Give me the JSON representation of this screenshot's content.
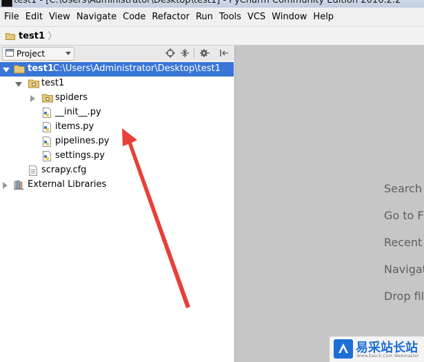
{
  "window": {
    "title": "test1 - [C:\\Users\\Administrator\\Desktop\\test1] - PyCharm Community Edition 2016.2.2"
  },
  "menu": [
    "File",
    "Edit",
    "View",
    "Navigate",
    "Code",
    "Refactor",
    "Run",
    "Tools",
    "VCS",
    "Window",
    "Help"
  ],
  "breadcrumb": {
    "project": "test1"
  },
  "panel": {
    "view_selector": "Project",
    "icons": [
      "locate-icon",
      "collapse-icon",
      "settings-icon",
      "hide-icon"
    ]
  },
  "tree": {
    "root": {
      "name": "test1",
      "path": "C:\\Users\\Administrator\\Desktop\\test1",
      "expanded": true,
      "selected": true
    },
    "items": [
      {
        "label": "test1",
        "type": "package",
        "expanded": true
      },
      {
        "label": "spiders",
        "type": "package",
        "expanded": false
      },
      {
        "label": "__init__.py",
        "type": "python-file"
      },
      {
        "label": "items.py",
        "type": "python-file"
      },
      {
        "label": "pipelines.py",
        "type": "python-file"
      },
      {
        "label": "settings.py",
        "type": "python-file"
      },
      {
        "label": "scrapy.cfg",
        "type": "config-file"
      },
      {
        "label": "External Libraries",
        "type": "libraries",
        "expanded": false
      }
    ]
  },
  "editor_hints": [
    "Search E",
    "Go to Fi",
    "Recent F",
    "Navigat",
    "Drop file"
  ],
  "watermark": {
    "text": "易采站长站",
    "sub": "Www.Easck.Com Webmaster"
  },
  "colors": {
    "selection": "#3875d7",
    "annotation_arrow": "#e8403a",
    "editor_bg": "#c6c6c6"
  }
}
